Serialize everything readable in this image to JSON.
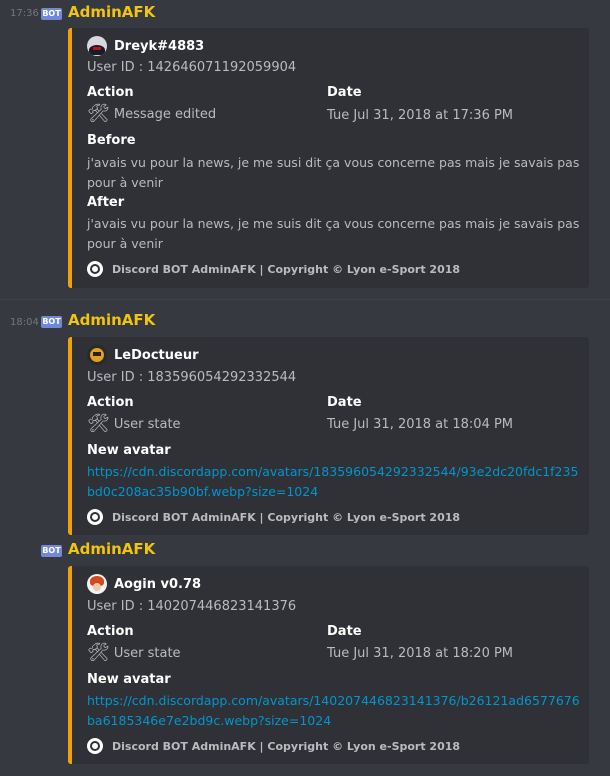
{
  "messages": [
    {
      "timestamp": "17:36",
      "bot_tag": "BOT",
      "author": "AdminAFK",
      "embed": {
        "user_name": "Dreyk#4883",
        "user_id": "User ID : 142646071192059904",
        "action_label": "Action",
        "action_value": "Message edited",
        "date_label": "Date",
        "date_value": "Tue Jul 31, 2018 at 17:36 PM",
        "before_label": "Before",
        "before_text": "j'avais vu pour la news, je me susi dit ça vous concerne pas mais je savais pas pour à venir",
        "after_label": "After",
        "after_text": "j'avais vu pour la news, je me suis dit ça vous concerne pas mais je savais pas pour à venir",
        "footer": "Discord BOT AdminAFK | Copyright © Lyon e-Sport 2018"
      }
    },
    {
      "timestamp": "18:04",
      "bot_tag": "BOT",
      "author": "AdminAFK",
      "embed": {
        "user_name": "LeDoctueur",
        "user_id": "User ID : 183596054292332544",
        "action_label": "Action",
        "action_value": "User state",
        "date_label": "Date",
        "date_value": "Tue Jul 31, 2018 at 18:04 PM",
        "field_label": "New avatar",
        "link": "https://cdn.discordapp.com/avatars/183596054292332544/93e2dc20fdc1f235bd0c208ac35b90bf.webp?size=1024",
        "footer": "Discord BOT AdminAFK | Copyright © Lyon e-Sport 2018"
      }
    },
    {
      "bot_tag": "BOT",
      "author": "AdminAFK",
      "embed": {
        "user_name": "Aogin v0.78",
        "user_id": "User ID : 140207446823141376",
        "action_label": "Action",
        "action_value": "User state",
        "date_label": "Date",
        "date_value": "Tue Jul 31, 2018 at 18:20 PM",
        "field_label": "New avatar",
        "link": "https://cdn.discordapp.com/avatars/140207446823141376/b26121ad6577676ba6185346e7e2bd9c.webp?size=1024",
        "footer": "Discord BOT AdminAFK | Copyright © Lyon e-Sport 2018"
      }
    }
  ],
  "colors": {
    "background": "#36393f",
    "embed_bg": "#2f3136",
    "embed_border": "#f1a209",
    "author": "#f1c40f",
    "link": "#0096cf",
    "bot_tag": "#7289da"
  },
  "icons": {
    "tool": "hammer-and-wrench-icon",
    "footer": "bot-logo-icon"
  }
}
